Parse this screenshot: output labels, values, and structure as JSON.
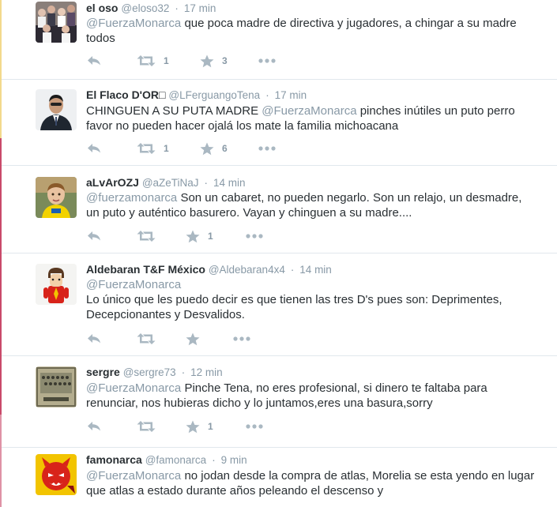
{
  "colors": {
    "name": "#292f33",
    "meta": "#8899a6",
    "icon": "#aab8c2",
    "divider": "#e1e8ed",
    "edge_top": "#f3d98c",
    "edge_bottom": "#c94a6a"
  },
  "tweets": [
    {
      "name": "el oso",
      "handle": "@eloso32",
      "dot": "·",
      "time": "17 min",
      "mention": "@FuerzaMonarca",
      "text": " que poca madre de directiva y jugadores, a chingar a su madre todos",
      "retweets": "1",
      "favorites": "3",
      "avatar": "crowd-photo"
    },
    {
      "name": "El Flaco D'OR",
      "handle": "@LFerguangoTena",
      "dot": "·",
      "time": "17 min",
      "lead": "CHINGUEN A SU PUTA MADRE ",
      "mention": "@FuerzaMonarca",
      "text": " pinches inútiles un puto perro favor no pueden hacer ojalá los mate la familia michoacana",
      "retweets": "1",
      "favorites": "6",
      "avatar": "man-in-suit"
    },
    {
      "name": "aLvArOZJ",
      "handle": "@aZeTiNaJ",
      "dot": "·",
      "time": "14 min",
      "mention": "@fuerzamonarca",
      "text": " Son un cabaret, no pueden negarlo. Son un relajo, un desmadre, un puto y auténtico basurero. Vayan y chinguen a su madre....",
      "retweets": "",
      "favorites": "1",
      "avatar": "boy-yellow-shirt"
    },
    {
      "name": "Aldebaran T&F México",
      "handle": "@Aldebaran4x4",
      "dot": "·",
      "time": "14 min",
      "mention": "@FuerzaMonarca",
      "text": "Lo único que les puedo decir es que tienen las tres D's pues son: Deprimentes, Decepcionantes y Desvalidos.",
      "retweets": "",
      "favorites": "",
      "avatar": "toy-figure"
    },
    {
      "name": "sergre",
      "handle": "@sergre73",
      "dot": "·",
      "time": "12 min",
      "mention": "@FuerzaMonarca",
      "text": " Pinche Tena, no eres profesional, si dinero te faltaba para renunciar, nos hubieras dicho y lo juntamos,eres una basura,sorry",
      "retweets": "",
      "favorites": "1",
      "avatar": "team-photo"
    },
    {
      "name": "famonarca",
      "handle": "@famonarca",
      "dot": "·",
      "time": "9 min",
      "mention": "@FuerzaMonarca",
      "text": " no jodan desde la compra de atlas, Morelia se esta yendo en lugar que atlas a estado durante años peleando el descenso y",
      "retweets": "",
      "favorites": "",
      "avatar": "red-devil-logo"
    }
  ]
}
